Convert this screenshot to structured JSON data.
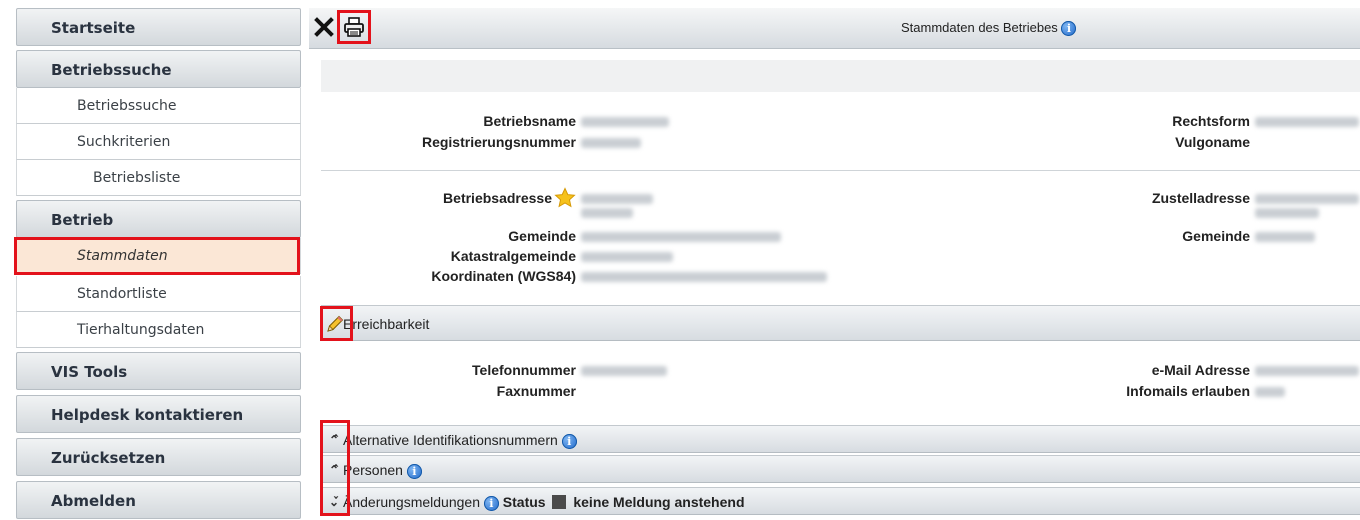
{
  "sidebar": {
    "startseite": "Startseite",
    "betriebssuche_head": "Betriebssuche",
    "betriebssuche": "Betriebssuche",
    "suchkriterien": "Suchkriterien",
    "betriebsliste": "Betriebsliste",
    "betrieb_head": "Betrieb",
    "stammdaten": "Stammdaten",
    "standortliste": "Standortliste",
    "tierhaltungsdaten": "Tierhaltungsdaten",
    "vis_tools": "VIS Tools",
    "helpdesk": "Helpdesk kontaktieren",
    "zuruecksetzen": "Zurücksetzen",
    "abmelden": "Abmelden"
  },
  "toolbar": {
    "close_icon": "close-icon",
    "print_icon": "printer-icon"
  },
  "header": {
    "title": "Stammdaten des Betriebes"
  },
  "fields": {
    "betriebsname": "Betriebsname",
    "registrierungsnummer": "Registrierungsnummer",
    "rechtsform": "Rechtsform",
    "vulgoname": "Vulgoname",
    "betriebsadresse": "Betriebsadresse",
    "gemeinde": "Gemeinde",
    "katastralgemeinde": "Katastralgemeinde",
    "koordinaten": "Koordinaten (WGS84)",
    "zustelladresse": "Zustelladresse",
    "gemeinde_right": "Gemeinde"
  },
  "erreichbarkeit": {
    "title": "Erreichbarkeit",
    "telefonnummer": "Telefonnummer",
    "faxnummer": "Faxnummer",
    "email": "e-Mail Adresse",
    "infomails": "Infomails erlauben"
  },
  "sections": {
    "alt_ids": "Alternative Identifikationsnummern",
    "personen": "Personen",
    "aenderungen": "Änderungsmeldungen",
    "status_label": "Status",
    "status_text": "keine Meldung anstehend"
  },
  "colors": {
    "highlight": "#e3121b",
    "active_bg": "#fbe7d6",
    "info_blue": "#1a64c8"
  }
}
